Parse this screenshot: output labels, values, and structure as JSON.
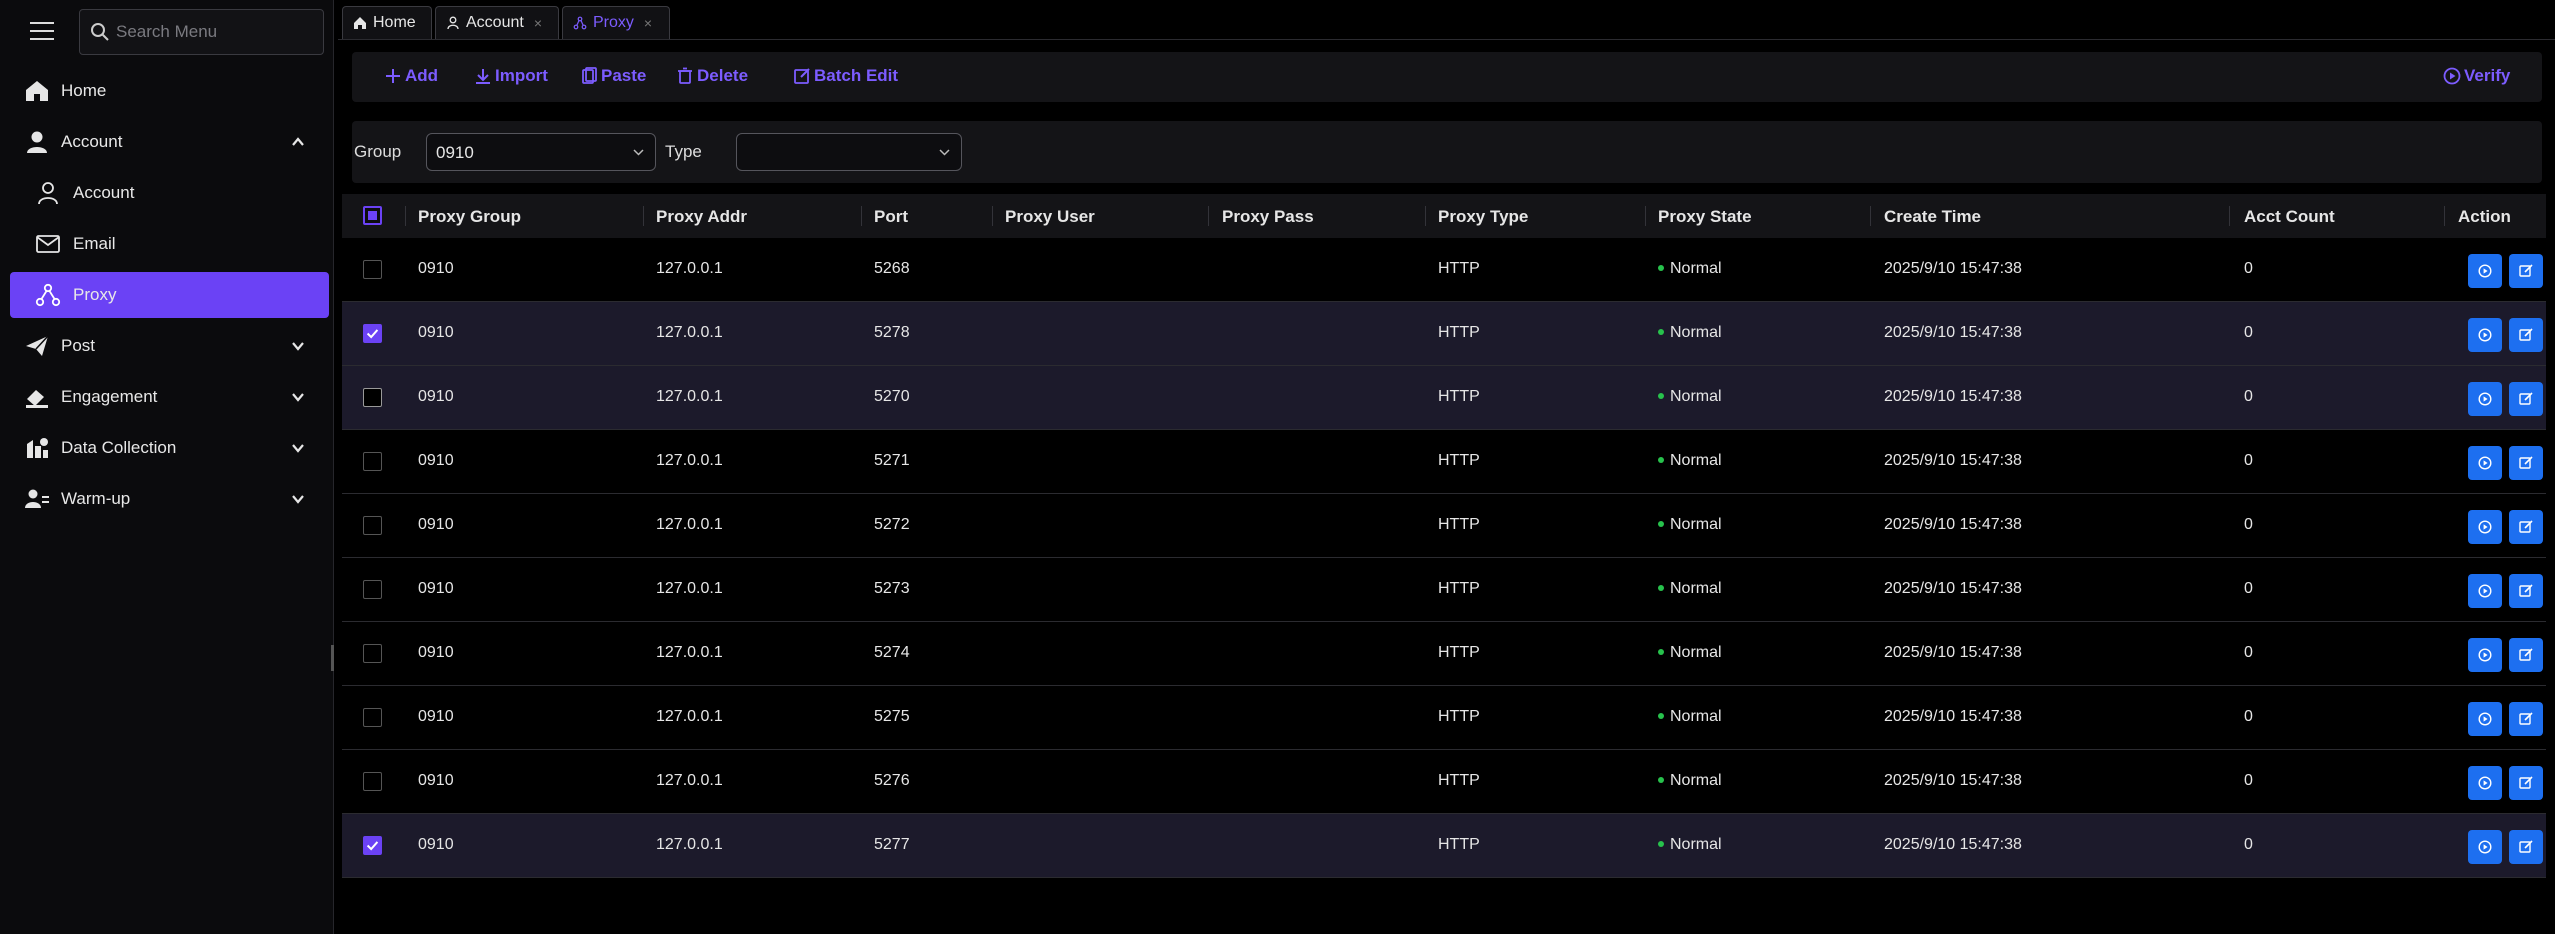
{
  "sidebar": {
    "search_placeholder": "Search Menu",
    "items": [
      {
        "label": "Home",
        "icon": "home-icon"
      },
      {
        "label": "Account",
        "icon": "user-icon",
        "expanded": true
      },
      {
        "label": "Account",
        "icon": "user-outline-icon",
        "sub": true
      },
      {
        "label": "Email",
        "icon": "mail-icon",
        "sub": true
      },
      {
        "label": "Proxy",
        "icon": "proxy-icon",
        "sub": true,
        "active": true
      },
      {
        "label": "Post",
        "icon": "send-icon"
      },
      {
        "label": "Engagement",
        "icon": "engagement-icon"
      },
      {
        "label": "Data Collection",
        "icon": "data-collection-icon"
      },
      {
        "label": "Warm-up",
        "icon": "warmup-icon"
      }
    ]
  },
  "tabs": [
    {
      "label": "Home",
      "icon": "home-icon"
    },
    {
      "label": "Account",
      "icon": "user-outline-icon",
      "close": "×"
    },
    {
      "label": "Proxy",
      "icon": "proxy-icon",
      "close": "×",
      "active": true
    }
  ],
  "toolbar": {
    "add": "Add",
    "import": "Import",
    "paste": "Paste",
    "delete": "Delete",
    "batch_edit": "Batch Edit",
    "verify": "Verify"
  },
  "filters": {
    "group_label": "Group",
    "group_value": "0910",
    "type_label": "Type",
    "type_value": ""
  },
  "table": {
    "headers": {
      "group": "Proxy Group",
      "addr": "Proxy Addr",
      "port": "Port",
      "user": "Proxy User",
      "pass": "Proxy Pass",
      "type": "Proxy Type",
      "state": "Proxy State",
      "time": "Create Time",
      "count": "Acct Count",
      "action": "Action"
    },
    "rows": [
      {
        "group": "0910",
        "addr": "127.0.0.1",
        "port": "5268",
        "user": "",
        "pass": "",
        "type": "HTTP",
        "state": "Normal",
        "time": "2025/9/10 15:47:38",
        "count": "0",
        "checked": false
      },
      {
        "group": "0910",
        "addr": "127.0.0.1",
        "port": "5278",
        "user": "",
        "pass": "",
        "type": "HTTP",
        "state": "Normal",
        "time": "2025/9/10 15:47:38",
        "count": "0",
        "checked": true
      },
      {
        "group": "0910",
        "addr": "127.0.0.1",
        "port": "5270",
        "user": "",
        "pass": "",
        "type": "HTTP",
        "state": "Normal",
        "time": "2025/9/10 15:47:38",
        "count": "0",
        "checked": false,
        "hover": true
      },
      {
        "group": "0910",
        "addr": "127.0.0.1",
        "port": "5271",
        "user": "",
        "pass": "",
        "type": "HTTP",
        "state": "Normal",
        "time": "2025/9/10 15:47:38",
        "count": "0",
        "checked": false
      },
      {
        "group": "0910",
        "addr": "127.0.0.1",
        "port": "5272",
        "user": "",
        "pass": "",
        "type": "HTTP",
        "state": "Normal",
        "time": "2025/9/10 15:47:38",
        "count": "0",
        "checked": false
      },
      {
        "group": "0910",
        "addr": "127.0.0.1",
        "port": "5273",
        "user": "",
        "pass": "",
        "type": "HTTP",
        "state": "Normal",
        "time": "2025/9/10 15:47:38",
        "count": "0",
        "checked": false
      },
      {
        "group": "0910",
        "addr": "127.0.0.1",
        "port": "5274",
        "user": "",
        "pass": "",
        "type": "HTTP",
        "state": "Normal",
        "time": "2025/9/10 15:47:38",
        "count": "0",
        "checked": false
      },
      {
        "group": "0910",
        "addr": "127.0.0.1",
        "port": "5275",
        "user": "",
        "pass": "",
        "type": "HTTP",
        "state": "Normal",
        "time": "2025/9/10 15:47:38",
        "count": "0",
        "checked": false
      },
      {
        "group": "0910",
        "addr": "127.0.0.1",
        "port": "5276",
        "user": "",
        "pass": "",
        "type": "HTTP",
        "state": "Normal",
        "time": "2025/9/10 15:47:38",
        "count": "0",
        "checked": false
      },
      {
        "group": "0910",
        "addr": "127.0.0.1",
        "port": "5277",
        "user": "",
        "pass": "",
        "type": "HTTP",
        "state": "Normal",
        "time": "2025/9/10 15:47:38",
        "count": "0",
        "checked": true
      }
    ]
  },
  "colors": {
    "accent": "#6b42f5",
    "accent_text": "#7c5cff",
    "action_button": "#1d6ff0",
    "status_ok": "#27c24c"
  }
}
